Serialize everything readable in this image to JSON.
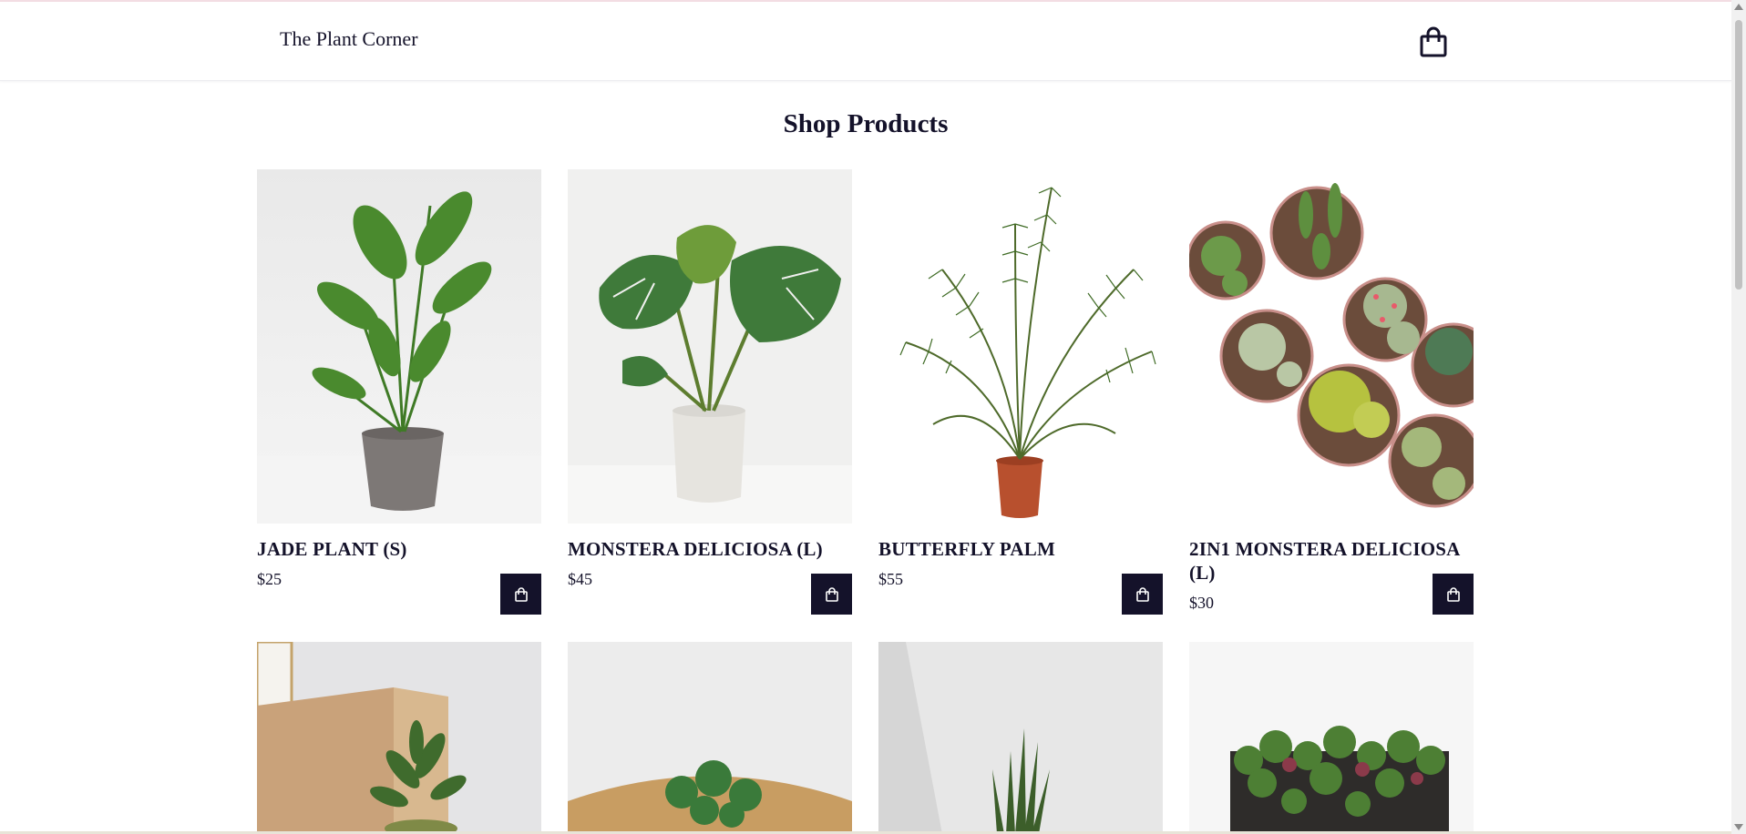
{
  "header": {
    "brand": "The Plant Corner",
    "cart_icon": "shopping-bag-icon"
  },
  "page_title": "Shop Products",
  "add_to_cart_icon": "shopping-bag-icon",
  "products": [
    {
      "name": "JADE PLANT (S)",
      "price": "$25"
    },
    {
      "name": "MONSTERA DELICIOSA (L)",
      "price": "$45"
    },
    {
      "name": "BUTTERFLY PALM",
      "price": "$55"
    },
    {
      "name": "2IN1 MONSTERA DELICIOSA (L)",
      "price": "$30"
    }
  ]
}
